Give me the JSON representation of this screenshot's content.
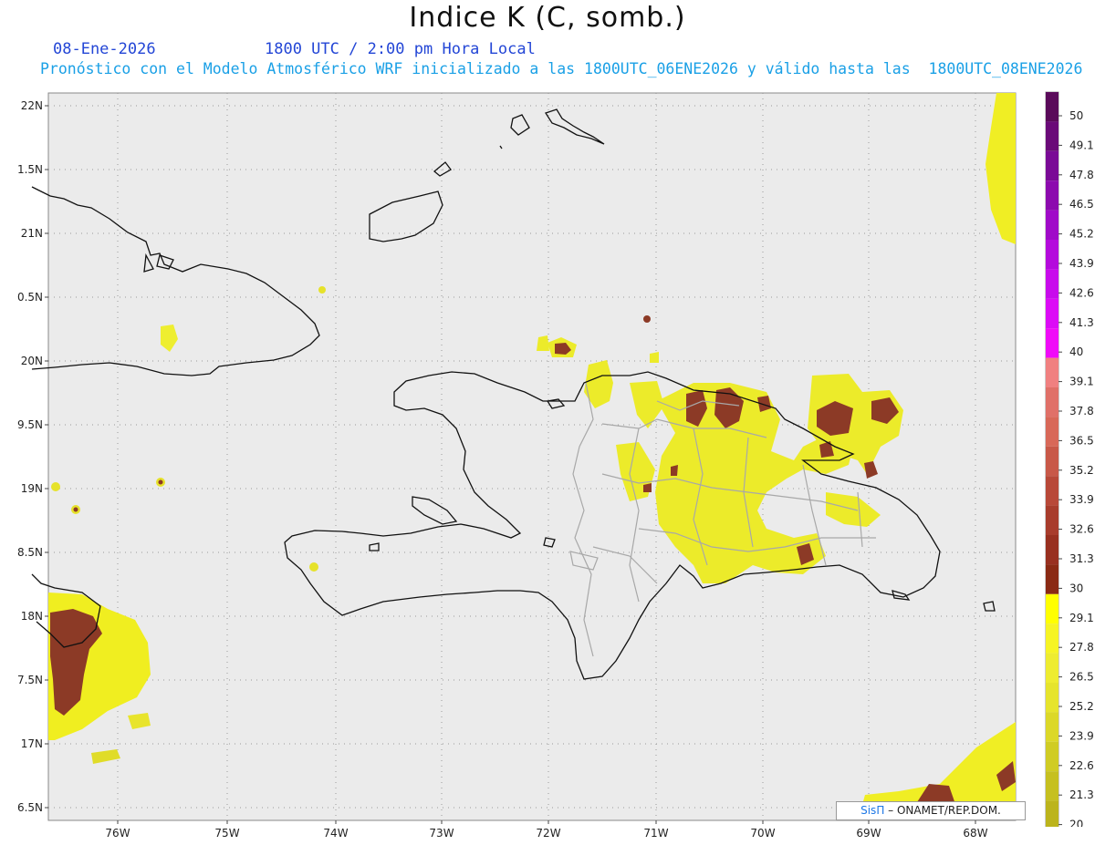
{
  "header": {
    "title": "Indice K (C, somb.)",
    "date": "08-Ene-2026",
    "time": "1800 UTC / 2:00 pm Hora Local",
    "forecast_line": "Pronóstico con el Modelo Atmosférico WRF inicializado a las 1800UTC_06ENE2026 y válido hasta las  1800UTC_08ENE2026"
  },
  "map": {
    "lat_labels": [
      "22N",
      "1.5N",
      "21N",
      "0.5N",
      "20N",
      "9.5N",
      "19N",
      "8.5N",
      "18N",
      "7.5N",
      "17N",
      "6.5N"
    ],
    "lon_labels": [
      "76W",
      "75W",
      "74W",
      "73W",
      "72W",
      "71W",
      "70W",
      "69W",
      "68W"
    ],
    "background_color": "#ebebeb",
    "grid": "dotted"
  },
  "legend": {
    "labels": [
      "50",
      "49.1",
      "47.8",
      "46.5",
      "45.2",
      "43.9",
      "42.6",
      "41.3",
      "40",
      "39.1",
      "37.8",
      "36.5",
      "35.2",
      "33.9",
      "32.6",
      "31.3",
      "30",
      "29.1",
      "27.8",
      "26.5",
      "25.2",
      "23.9",
      "22.6",
      "21.3",
      "20"
    ],
    "colors": [
      "#5a0a5a",
      "#6a0a78",
      "#7a0a96",
      "#8c0aae",
      "#a00ac8",
      "#b40adc",
      "#c80aec",
      "#dc0af6",
      "#f00af8",
      "#f08080",
      "#e07068",
      "#d86858",
      "#c85848",
      "#b84838",
      "#a83c2c",
      "#983020",
      "#8a2a14",
      "#ffff00",
      "#f6f424",
      "#eeec30",
      "#e6e42c",
      "#dcd828",
      "#d0cc24",
      "#c6c020",
      "#bcb41c"
    ]
  },
  "credit": {
    "brand": "SisΠ",
    "org": " – ONAMET/REP.DOM."
  }
}
